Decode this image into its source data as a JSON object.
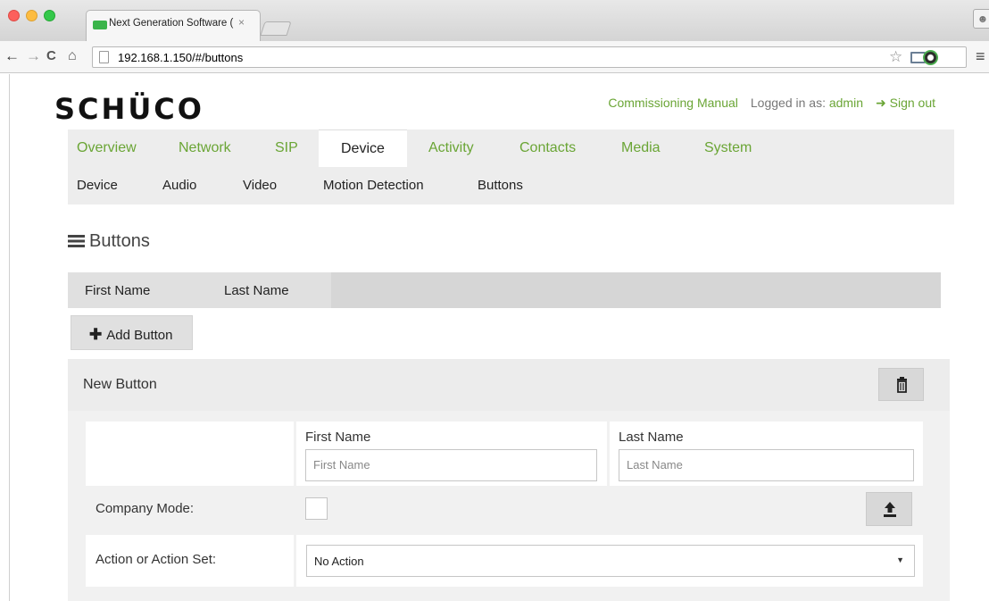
{
  "browser": {
    "tab_title": "Next Generation Software (",
    "tab_close": "×",
    "url": "192.168.1.150/#/buttons",
    "icons": [
      "back-arrow-icon",
      "forward-arrow-icon",
      "reload-icon",
      "home-icon",
      "page-icon",
      "star-icon",
      "cast-icon",
      "extension-icon",
      "menu-icon",
      "profile-icon"
    ]
  },
  "header": {
    "logo": "SCHÜCO",
    "manual_link": "Commissioning Manual",
    "logged_in_label": "Logged in as:",
    "username": "admin",
    "signout_label": "Sign out",
    "accent_color": "#6aa535"
  },
  "main_nav": [
    {
      "label": "Overview"
    },
    {
      "label": "Network"
    },
    {
      "label": "SIP"
    },
    {
      "label": "Device",
      "active": true
    },
    {
      "label": "Activity"
    },
    {
      "label": "Contacts"
    },
    {
      "label": "Media"
    },
    {
      "label": "System"
    }
  ],
  "sub_nav": [
    {
      "label": "Device"
    },
    {
      "label": "Audio"
    },
    {
      "label": "Video"
    },
    {
      "label": "Motion Detection"
    },
    {
      "label": "Buttons",
      "active": true
    }
  ],
  "section": {
    "title": "Buttons",
    "columns": [
      "First Name",
      "Last Name"
    ],
    "add_button": "Add Button"
  },
  "panel": {
    "title": "New Button",
    "first_name_label": "First Name",
    "first_name_placeholder": "First Name",
    "first_name_value": "",
    "last_name_label": "Last Name",
    "last_name_placeholder": "Last Name",
    "last_name_value": "",
    "company_mode_label": "Company Mode:",
    "company_mode_checked": false,
    "action_label": "Action or Action Set:",
    "action_value": "No Action"
  }
}
